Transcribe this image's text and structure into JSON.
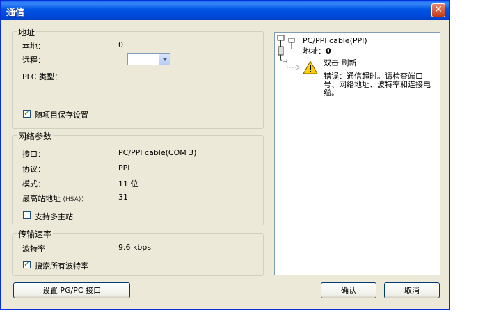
{
  "window": {
    "title": "通信",
    "close_symbol": "✕"
  },
  "address_group": {
    "title": "地址",
    "local_label": "本地：",
    "local_value": "0",
    "remote_label": "远程：",
    "remote_value": "",
    "plc_type_label": "PLC 类型：",
    "save_with_project_label": "随项目保存设置",
    "save_with_project_checked": true
  },
  "network_group": {
    "title": "网络参数",
    "interface_label": "接口：",
    "interface_value": "PC/PPI cable(COM 3)",
    "protocol_label": "协议：",
    "protocol_value": "PPI",
    "mode_label": "模式：",
    "mode_value": "11 位",
    "hsa_label": "最高站地址",
    "hsa_paren": "(HSA)",
    "hsa_colon": "：",
    "hsa_value": "31",
    "multi_master_label": "支持多主站",
    "multi_master_checked": false
  },
  "baud_group": {
    "title": "传输速率",
    "baud_label": "波特率",
    "baud_value": "9.6 kbps",
    "search_all_label": "搜索所有波特率",
    "search_all_checked": true
  },
  "tree": {
    "cable_name": "PC/PPI cable(PPI)",
    "address_label": "地址：",
    "address_value": "0",
    "refresh_label": "双击 刷新",
    "error_text": "错误：通信超时。请检查端口号、网络地址、波特率和连接电缆。"
  },
  "buttons": {
    "set_pgpc": "设置 PG/PC 接口",
    "ok": "确认",
    "cancel": "取消"
  },
  "checkmark": "✓"
}
